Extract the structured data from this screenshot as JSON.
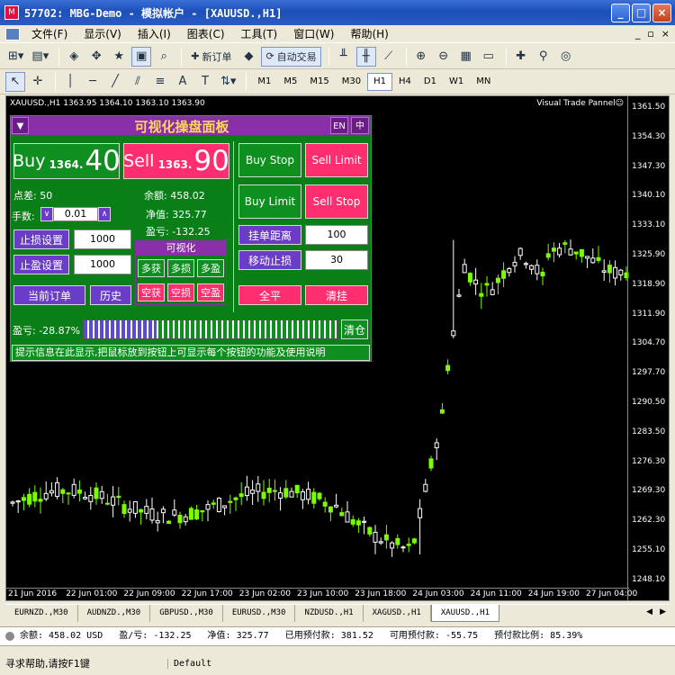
{
  "window": {
    "title": "57702: MBG-Demo - 模拟帐户 - [XAUUSD.,H1]"
  },
  "menu": [
    "文件(F)",
    "显示(V)",
    "插入(I)",
    "图表(C)",
    "工具(T)",
    "窗口(W)",
    "帮助(H)"
  ],
  "toolbar": {
    "new_order": "新订单",
    "auto_trading": "自动交易",
    "timeframes": [
      "M1",
      "M5",
      "M15",
      "M30",
      "H1",
      "H4",
      "D1",
      "W1",
      "MN"
    ],
    "active_timeframe": "H1"
  },
  "chart": {
    "symbol_info": "XAUUSD.,H1  1363.95 1364.10 1363.10 1363.90",
    "indicator_label": "Visual Trade Pannel☺",
    "price_ticks": [
      "1361.50",
      "1354.30",
      "1347.30",
      "1340.10",
      "1333.10",
      "1325.90",
      "1318.90",
      "1311.90",
      "1304.70",
      "1297.70",
      "1290.50",
      "1283.50",
      "1276.30",
      "1269.30",
      "1262.30",
      "1255.10",
      "1248.10"
    ],
    "time_ticks": [
      "21 Jun 2016",
      "22 Jun 01:00",
      "22 Jun 09:00",
      "22 Jun 17:00",
      "23 Jun 02:00",
      "23 Jun 10:00",
      "23 Jun 18:00",
      "24 Jun 03:00",
      "24 Jun 11:00",
      "24 Jun 19:00",
      "27 Jun 04:00"
    ],
    "bull_color": "#ffffff",
    "bear_color": "#7cfc00"
  },
  "panel": {
    "toggle": "▼",
    "title": "可视化操盘面板",
    "lang_en": "EN",
    "lang_zh": "中",
    "buy_label": "Buy",
    "buy_small": "1364.",
    "buy_big": "40",
    "sell_label": "Sell",
    "sell_small": "1363.",
    "sell_big": "90",
    "spread": "点差: 50",
    "lots_label": "手数:",
    "lots_value": "0.01",
    "balance": "余额: 458.02",
    "equity": "净值: 325.77",
    "profit": "盈亏: -132.25",
    "sl_label": "止损设置",
    "sl_value": "1000",
    "tp_label": "止盈设置",
    "tp_value": "1000",
    "current_orders": "当前订单",
    "history": "历史",
    "visual_title": "可视化",
    "vis_buttons": [
      "多获",
      "多损",
      "多盈",
      "空获",
      "空损",
      "空盈"
    ],
    "buy_stop": "Buy Stop",
    "sell_limit": "Sell Limit",
    "buy_limit": "Buy Limit",
    "sell_stop": "Sell Stop",
    "pending_distance_label": "挂单距离",
    "pending_distance_value": "100",
    "trailing_label": "移动止损",
    "trailing_value": "30",
    "close_all": "全平",
    "clear": "清挂",
    "pl_percent_label": "盈亏: -28.87%",
    "pl_percent_value": 28.87,
    "clear_position": "清仓",
    "hint": "提示信息在此显示,把鼠标放到按钮上可显示每个按钮的功能及使用说明"
  },
  "tabs": [
    "EURNZD.,M30",
    "AUDNZD.,M30",
    "GBPUSD.,M30",
    "EURUSD.,M30",
    "NZDUSD.,H1",
    "XAGUSD.,H1",
    "XAUUSD.,H1"
  ],
  "active_tab": "XAUUSD.,H1",
  "account": {
    "balance": "余额: 458.02 USD",
    "profit": "盈/亏: -132.25",
    "equity": "净值: 325.77",
    "margin": "已用预付款: 381.52",
    "free_margin": "可用预付款: -55.75",
    "margin_level": "预付款比例: 85.39%"
  },
  "status": {
    "help": "寻求帮助,请按F1键",
    "profile": "Default"
  }
}
